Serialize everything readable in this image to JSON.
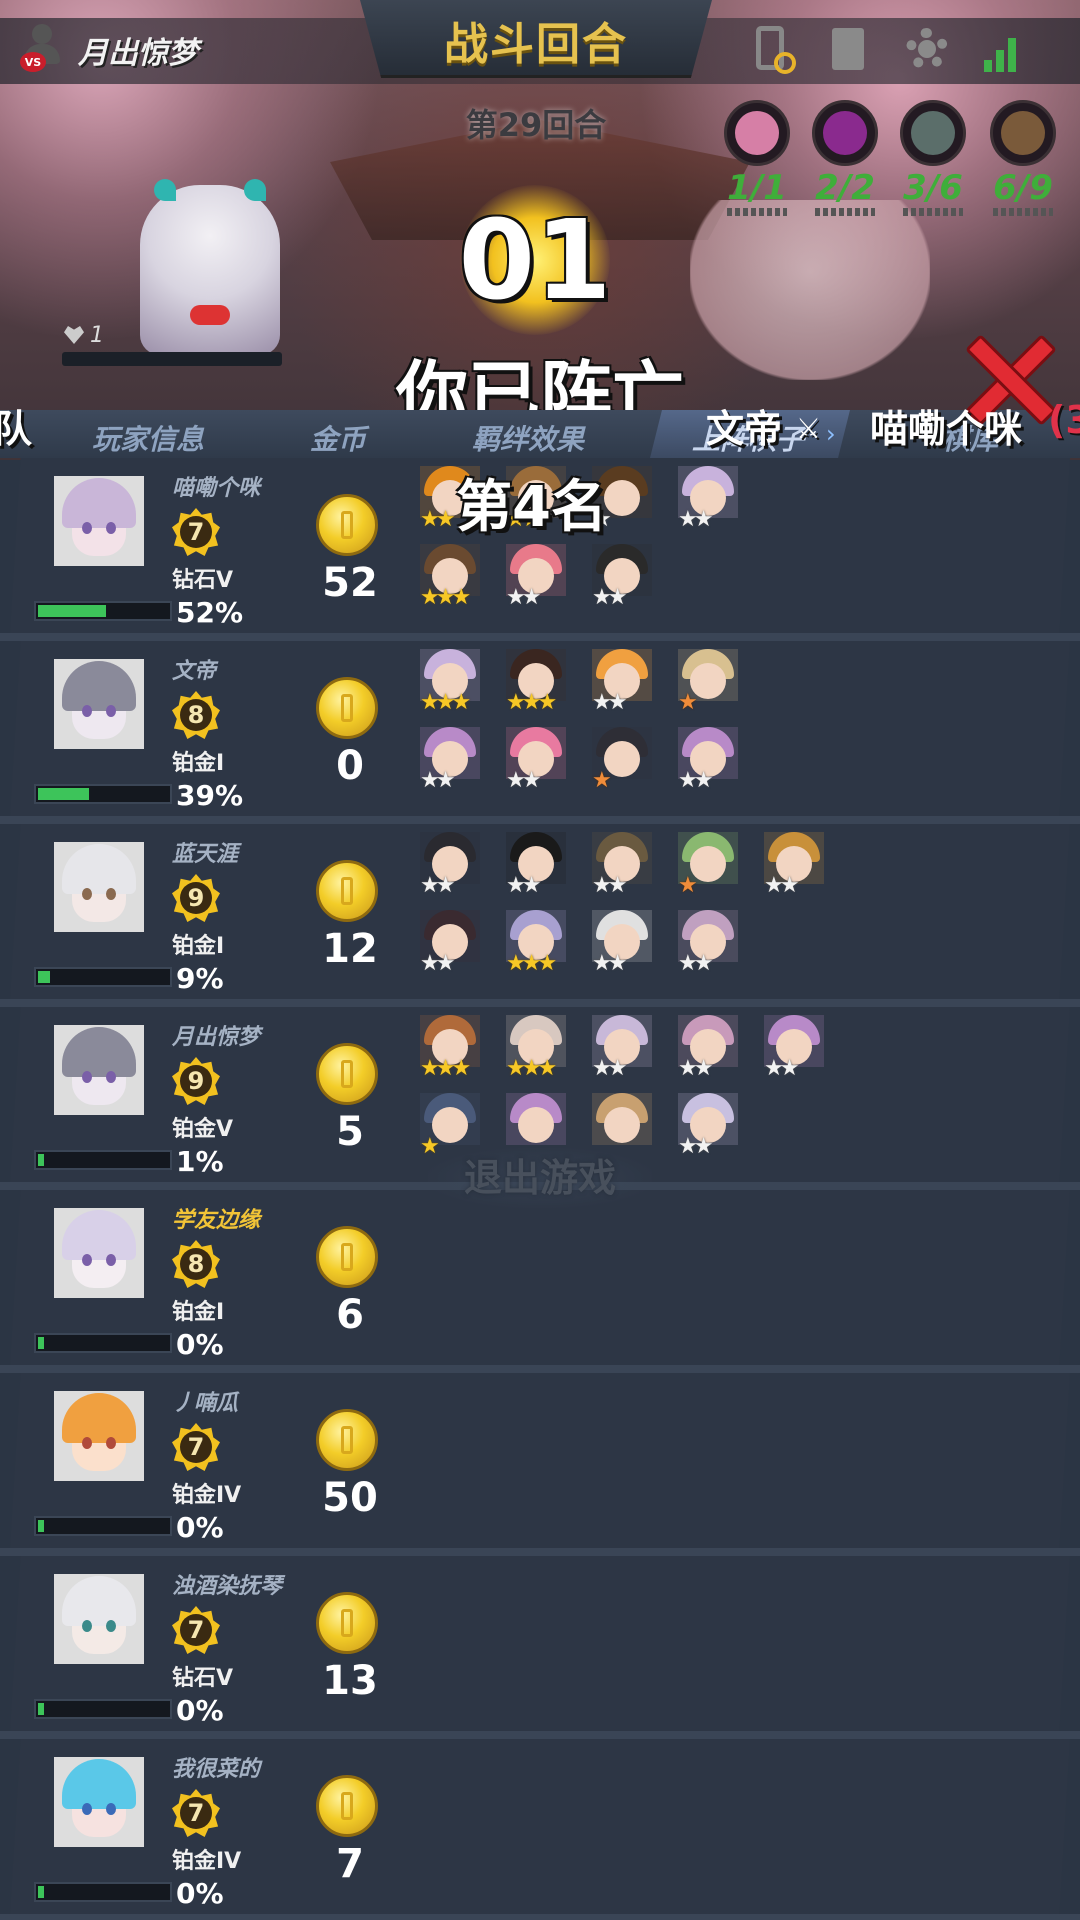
{
  "header": {
    "player_name": "月出惊梦",
    "title": "战斗回合",
    "round": "第29回合",
    "icons": [
      "phone-switch-icon",
      "book-icon",
      "gear-icon",
      "signal-icon"
    ]
  },
  "synergies": [
    {
      "icon": "sakura-icon",
      "value": "1/1",
      "color": "#d67fa6",
      "text_color": "#3fae3a"
    },
    {
      "icon": "vortex-icon",
      "value": "2/2",
      "color": "#8a2a8e",
      "text_color": "#3fae3a"
    },
    {
      "icon": "moon-icon",
      "value": "3/6",
      "color": "#5b6e6a",
      "text_color": "#3fae3a"
    },
    {
      "icon": "hammer-icon",
      "value": "6/9",
      "color": "#7a5a3a",
      "text_color": "#3fae3a"
    }
  ],
  "spectate": {
    "hp": "1",
    "countdown": "01",
    "status": "你已阵亡",
    "placement": "第4名"
  },
  "kill_feed": {
    "left_fragment": "队",
    "killer": "文帝",
    "icon": "crossed-swords-icon",
    "victim": "喵嘞个咪",
    "count_fragment": "(3"
  },
  "tabs": [
    "玩家信息",
    "金币",
    "羁绊效果",
    "上阵棋子",
    "棋库"
  ],
  "players": [
    {
      "name": "喵嘞个咪",
      "name_gold": false,
      "level": "7",
      "rank": "钻石V",
      "exp": "52%",
      "exp_value": 0.52,
      "coins": "52",
      "avatar": {
        "hair": "#c9b6d8",
        "skin": "#f3e2e8",
        "eye": "#7a5fa8"
      },
      "units": [
        {
          "hair": "#e0891c",
          "stars": "gold",
          "n": 2,
          "row": 0,
          "col": 0
        },
        {
          "hair": "#9a6c3a",
          "stars": "gold",
          "n": 2,
          "row": 0,
          "col": 1
        },
        {
          "hair": "#5a3c20",
          "stars": "silver",
          "n": 1,
          "row": 0,
          "col": 2
        },
        {
          "hair": "#c8b2dc",
          "stars": "silver",
          "n": 2,
          "row": 0,
          "col": 3
        },
        {
          "hair": "#6a4a30",
          "stars": "gold",
          "n": 3,
          "row": 1,
          "col": 0
        },
        {
          "hair": "#e87a8a",
          "stars": "silver",
          "n": 2,
          "row": 1,
          "col": 1
        },
        {
          "hair": "#2a2a2a",
          "stars": "silver",
          "n": 2,
          "row": 1,
          "col": 2
        }
      ]
    },
    {
      "name": "文帝",
      "name_gold": false,
      "level": "8",
      "rank": "铂金I",
      "exp": "39%",
      "exp_value": 0.39,
      "coins": "0",
      "avatar": {
        "hair": "#8a8a9a",
        "skin": "#eee8f0",
        "eye": "#7a5fa8"
      },
      "units": [
        {
          "hair": "#c8b2dc",
          "stars": "gold",
          "n": 3,
          "row": 0,
          "col": 0
        },
        {
          "hair": "#3a2620",
          "stars": "gold",
          "n": 3,
          "row": 0,
          "col": 1
        },
        {
          "hair": "#f0a040",
          "stars": "silver",
          "n": 2,
          "row": 0,
          "col": 2
        },
        {
          "hair": "#d8c090",
          "stars": "bronze",
          "n": 1,
          "row": 0,
          "col": 3
        },
        {
          "hair": "#b88ac8",
          "stars": "silver",
          "n": 2,
          "row": 1,
          "col": 0
        },
        {
          "hair": "#e87aa0",
          "stars": "silver",
          "n": 2,
          "row": 1,
          "col": 1
        },
        {
          "hair": "#2e2e36",
          "stars": "bronze",
          "n": 1,
          "row": 1,
          "col": 2
        },
        {
          "hair": "#b88ac8",
          "stars": "silver",
          "n": 2,
          "row": 1,
          "col": 3
        }
      ]
    },
    {
      "name": "蓝天涯",
      "name_gold": false,
      "level": "9",
      "rank": "铂金I",
      "exp": "9%",
      "exp_value": 0.09,
      "coins": "12",
      "avatar": {
        "hair": "#e6e6ea",
        "skin": "#f3e8e6",
        "eye": "#8a6a50"
      },
      "units": [
        {
          "hair": "#2a2a30",
          "stars": "silver",
          "n": 2,
          "row": 0,
          "col": 0
        },
        {
          "hair": "#1a1a1a",
          "stars": "silver",
          "n": 2,
          "row": 0,
          "col": 1
        },
        {
          "hair": "#6a5a40",
          "stars": "silver",
          "n": 2,
          "row": 0,
          "col": 2
        },
        {
          "hair": "#8ab870",
          "stars": "bronze",
          "n": 1,
          "row": 0,
          "col": 3
        },
        {
          "hair": "#c8903a",
          "stars": "silver",
          "n": 2,
          "row": 0,
          "col": 4
        },
        {
          "hair": "#3a2a30",
          "stars": "silver",
          "n": 2,
          "row": 1,
          "col": 0
        },
        {
          "hair": "#a8a0d0",
          "stars": "gold",
          "n": 3,
          "row": 1,
          "col": 1
        },
        {
          "hair": "#e0e0e0",
          "stars": "silver",
          "n": 2,
          "row": 1,
          "col": 2
        },
        {
          "hair": "#c0a0c0",
          "stars": "silver",
          "n": 2,
          "row": 1,
          "col": 3
        }
      ]
    },
    {
      "name": "月出惊梦",
      "name_gold": false,
      "level": "9",
      "rank": "铂金V",
      "exp": "1%",
      "exp_value": 0.01,
      "coins": "5",
      "avatar": {
        "hair": "#8a8a9a",
        "skin": "#eee8f0",
        "eye": "#7a5fa8"
      },
      "units": [
        {
          "hair": "#b06a3a",
          "stars": "gold",
          "n": 3,
          "row": 0,
          "col": 0
        },
        {
          "hair": "#d8c8c0",
          "stars": "gold",
          "n": 3,
          "row": 0,
          "col": 1
        },
        {
          "hair": "#c8b8d8",
          "stars": "silver",
          "n": 2,
          "row": 0,
          "col": 2
        },
        {
          "hair": "#c89aba",
          "stars": "silver",
          "n": 2,
          "row": 0,
          "col": 3
        },
        {
          "hair": "#b88ac8",
          "stars": "silver",
          "n": 2,
          "row": 0,
          "col": 4
        },
        {
          "hair": "#4a5a7a",
          "stars": "gold",
          "n": 1,
          "row": 1,
          "col": 0
        },
        {
          "hair": "#b88ac8",
          "stars": "silver",
          "n": 0,
          "row": 1,
          "col": 1
        },
        {
          "hair": "#c8a070",
          "stars": "silver",
          "n": 0,
          "row": 1,
          "col": 2
        },
        {
          "hair": "#c8c0e0",
          "stars": "silver",
          "n": 2,
          "row": 1,
          "col": 3
        }
      ]
    },
    {
      "name": "学友边缘",
      "name_gold": true,
      "level": "8",
      "rank": "铂金I",
      "exp": "0%",
      "exp_value": 0.0,
      "coins": "6",
      "avatar": {
        "hair": "#d8d0e8",
        "skin": "#f4eef2",
        "eye": "#7a5fa8"
      },
      "units": []
    },
    {
      "name": "丿喃瓜",
      "name_gold": false,
      "level": "7",
      "rank": "铂金IV",
      "exp": "0%",
      "exp_value": 0.0,
      "coins": "50",
      "avatar": {
        "hair": "#f0a040",
        "skin": "#fbe0cc",
        "eye": "#b04a3a"
      },
      "units": []
    },
    {
      "name": "浊酒染抚琴",
      "name_gold": false,
      "level": "7",
      "rank": "钻石V",
      "exp": "0%",
      "exp_value": 0.0,
      "coins": "13",
      "avatar": {
        "hair": "#e8e8ec",
        "skin": "#f4eae6",
        "eye": "#3a8a8a"
      },
      "units": []
    },
    {
      "name": "我很菜的",
      "name_gold": false,
      "level": "7",
      "rank": "铂金IV",
      "exp": "0%",
      "exp_value": 0.0,
      "coins": "7",
      "avatar": {
        "hair": "#5ac8e8",
        "skin": "#f6e2e0",
        "eye": "#3a6ab8"
      },
      "units": []
    }
  ],
  "exit_button": "退出游戏"
}
